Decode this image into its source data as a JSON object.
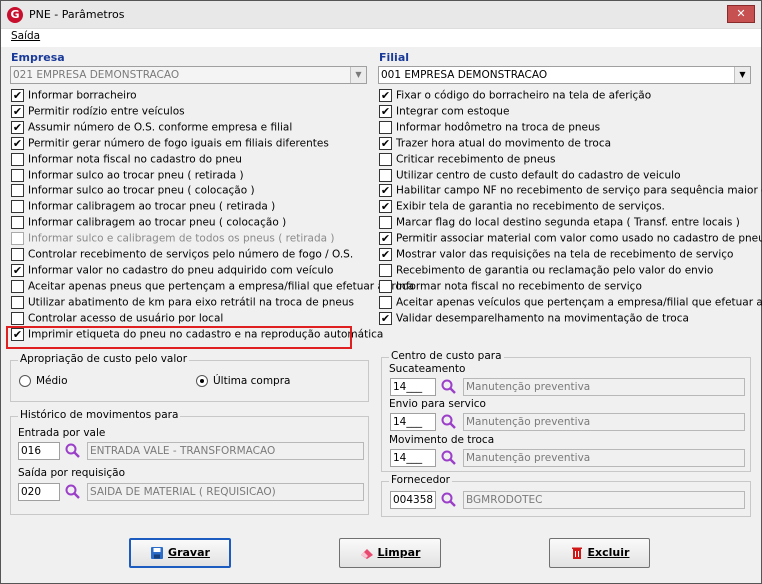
{
  "window": {
    "title": "PNE - Parâmetros",
    "app_icon_letter": "G"
  },
  "menu": {
    "saida": "Saída"
  },
  "empresa": {
    "label": "Empresa",
    "selected": "021 EMPRESA DEMONSTRACAO"
  },
  "filial": {
    "label": "Filial",
    "selected": "001 EMPRESA DEMONSTRACAO"
  },
  "empresa_options": [
    {
      "label": "Informar borracheiro",
      "checked": true,
      "enabled": true
    },
    {
      "label": "Permitir rodízio entre veículos",
      "checked": true,
      "enabled": true
    },
    {
      "label": "Assumir número de O.S. conforme empresa e filial",
      "checked": true,
      "enabled": true
    },
    {
      "label": "Permitir gerar número de fogo iguais em filiais diferentes",
      "checked": true,
      "enabled": true
    },
    {
      "label": "Informar nota fiscal no cadastro do pneu",
      "checked": false,
      "enabled": true
    },
    {
      "label": "Informar sulco ao trocar pneu ( retirada )",
      "checked": false,
      "enabled": true
    },
    {
      "label": "Informar sulco ao trocar pneu ( colocação )",
      "checked": false,
      "enabled": true
    },
    {
      "label": "Informar calibragem ao trocar pneu ( retirada )",
      "checked": false,
      "enabled": true
    },
    {
      "label": "Informar calibragem ao trocar pneu ( colocação )",
      "checked": false,
      "enabled": true
    },
    {
      "label": "Informar sulco e calibragem de todos os pneus ( retirada )",
      "checked": false,
      "enabled": false
    },
    {
      "label": "Controlar recebimento de serviços pelo número de fogo / O.S.",
      "checked": false,
      "enabled": true
    },
    {
      "label": "Informar valor no cadastro do pneu adquirido com veículo",
      "checked": true,
      "enabled": true
    },
    {
      "label": "Aceitar apenas pneus que pertençam a empresa/filial que efetuar a troca",
      "checked": false,
      "enabled": true
    },
    {
      "label": "Utilizar abatimento de km para eixo retrátil na troca de pneus",
      "checked": false,
      "enabled": true
    },
    {
      "label": "Controlar acesso de usuário por local",
      "checked": false,
      "enabled": true
    },
    {
      "label": "Imprimir etiqueta do pneu no cadastro e na reprodução automática",
      "checked": true,
      "enabled": true
    }
  ],
  "filial_options": [
    {
      "label": "Fixar o código do borracheiro na tela de aferição",
      "checked": true
    },
    {
      "label": "Integrar com estoque",
      "checked": true
    },
    {
      "label": "Informar hodômetro na troca de pneus",
      "checked": false
    },
    {
      "label": "Trazer hora atual do movimento de troca",
      "checked": true
    },
    {
      "label": "Criticar recebimento de pneus",
      "checked": false
    },
    {
      "label": "Utilizar centro de custo default do cadastro de veiculo",
      "checked": false
    },
    {
      "label": "Habilitar campo NF no recebimento de serviço para sequência maior que 1",
      "checked": true
    },
    {
      "label": "Exibir tela de garantia no recebimento de serviços.",
      "checked": true
    },
    {
      "label": "Marcar flag do local destino segunda etapa ( Transf. entre locais )",
      "checked": false
    },
    {
      "label": "Permitir associar material com valor como usado no cadastro de pneus",
      "checked": true
    },
    {
      "label": "Mostrar valor das requisições na tela de recebimento de serviço",
      "checked": true
    },
    {
      "label": "Recebimento de garantia ou reclamação pelo valor do envio",
      "checked": false
    },
    {
      "label": "Informar nota fiscal no recebimento de serviço",
      "checked": false
    },
    {
      "label": "Aceitar apenas veículos que pertençam a empresa/filial que efetuar a troca",
      "checked": false
    },
    {
      "label": "Validar desemparelhamento na movimentação de troca",
      "checked": true
    }
  ],
  "apropriacao": {
    "title": "Apropriação de custo pelo valor",
    "options": [
      {
        "label": "Médio",
        "selected": false
      },
      {
        "label": "Última compra",
        "selected": true
      }
    ]
  },
  "historico": {
    "title": "Histórico de movimentos para",
    "entrada_label": "Entrada por vale",
    "entrada_code": "016",
    "entrada_desc": "ENTRADA VALE - TRANSFORMACAO",
    "saida_label": "Saída por requisição",
    "saida_code": "020",
    "saida_desc": "SAIDA DE MATERIAL ( REQUISICAO)"
  },
  "centro_custo": {
    "title": "Centro de custo para",
    "sucateamento_label": "Sucateamento",
    "sucateamento_code": "14___",
    "sucateamento_desc": "Manutenção preventiva",
    "envio_label": "Envio para servico",
    "envio_code": "14___",
    "envio_desc": "Manutenção preventiva",
    "movimento_label": "Movimento de troca",
    "movimento_code": "14___",
    "movimento_desc": "Manutenção preventiva"
  },
  "fornecedor": {
    "title": "Fornecedor",
    "code": "004358",
    "desc": "BGMRODOTEC"
  },
  "buttons": {
    "gravar": "Gravar",
    "limpar": "Limpar",
    "excluir": "Excluir"
  },
  "colors": {
    "section_label": "#1a3a9a",
    "highlight": "#e02020",
    "lens": "#9b3fc9"
  }
}
